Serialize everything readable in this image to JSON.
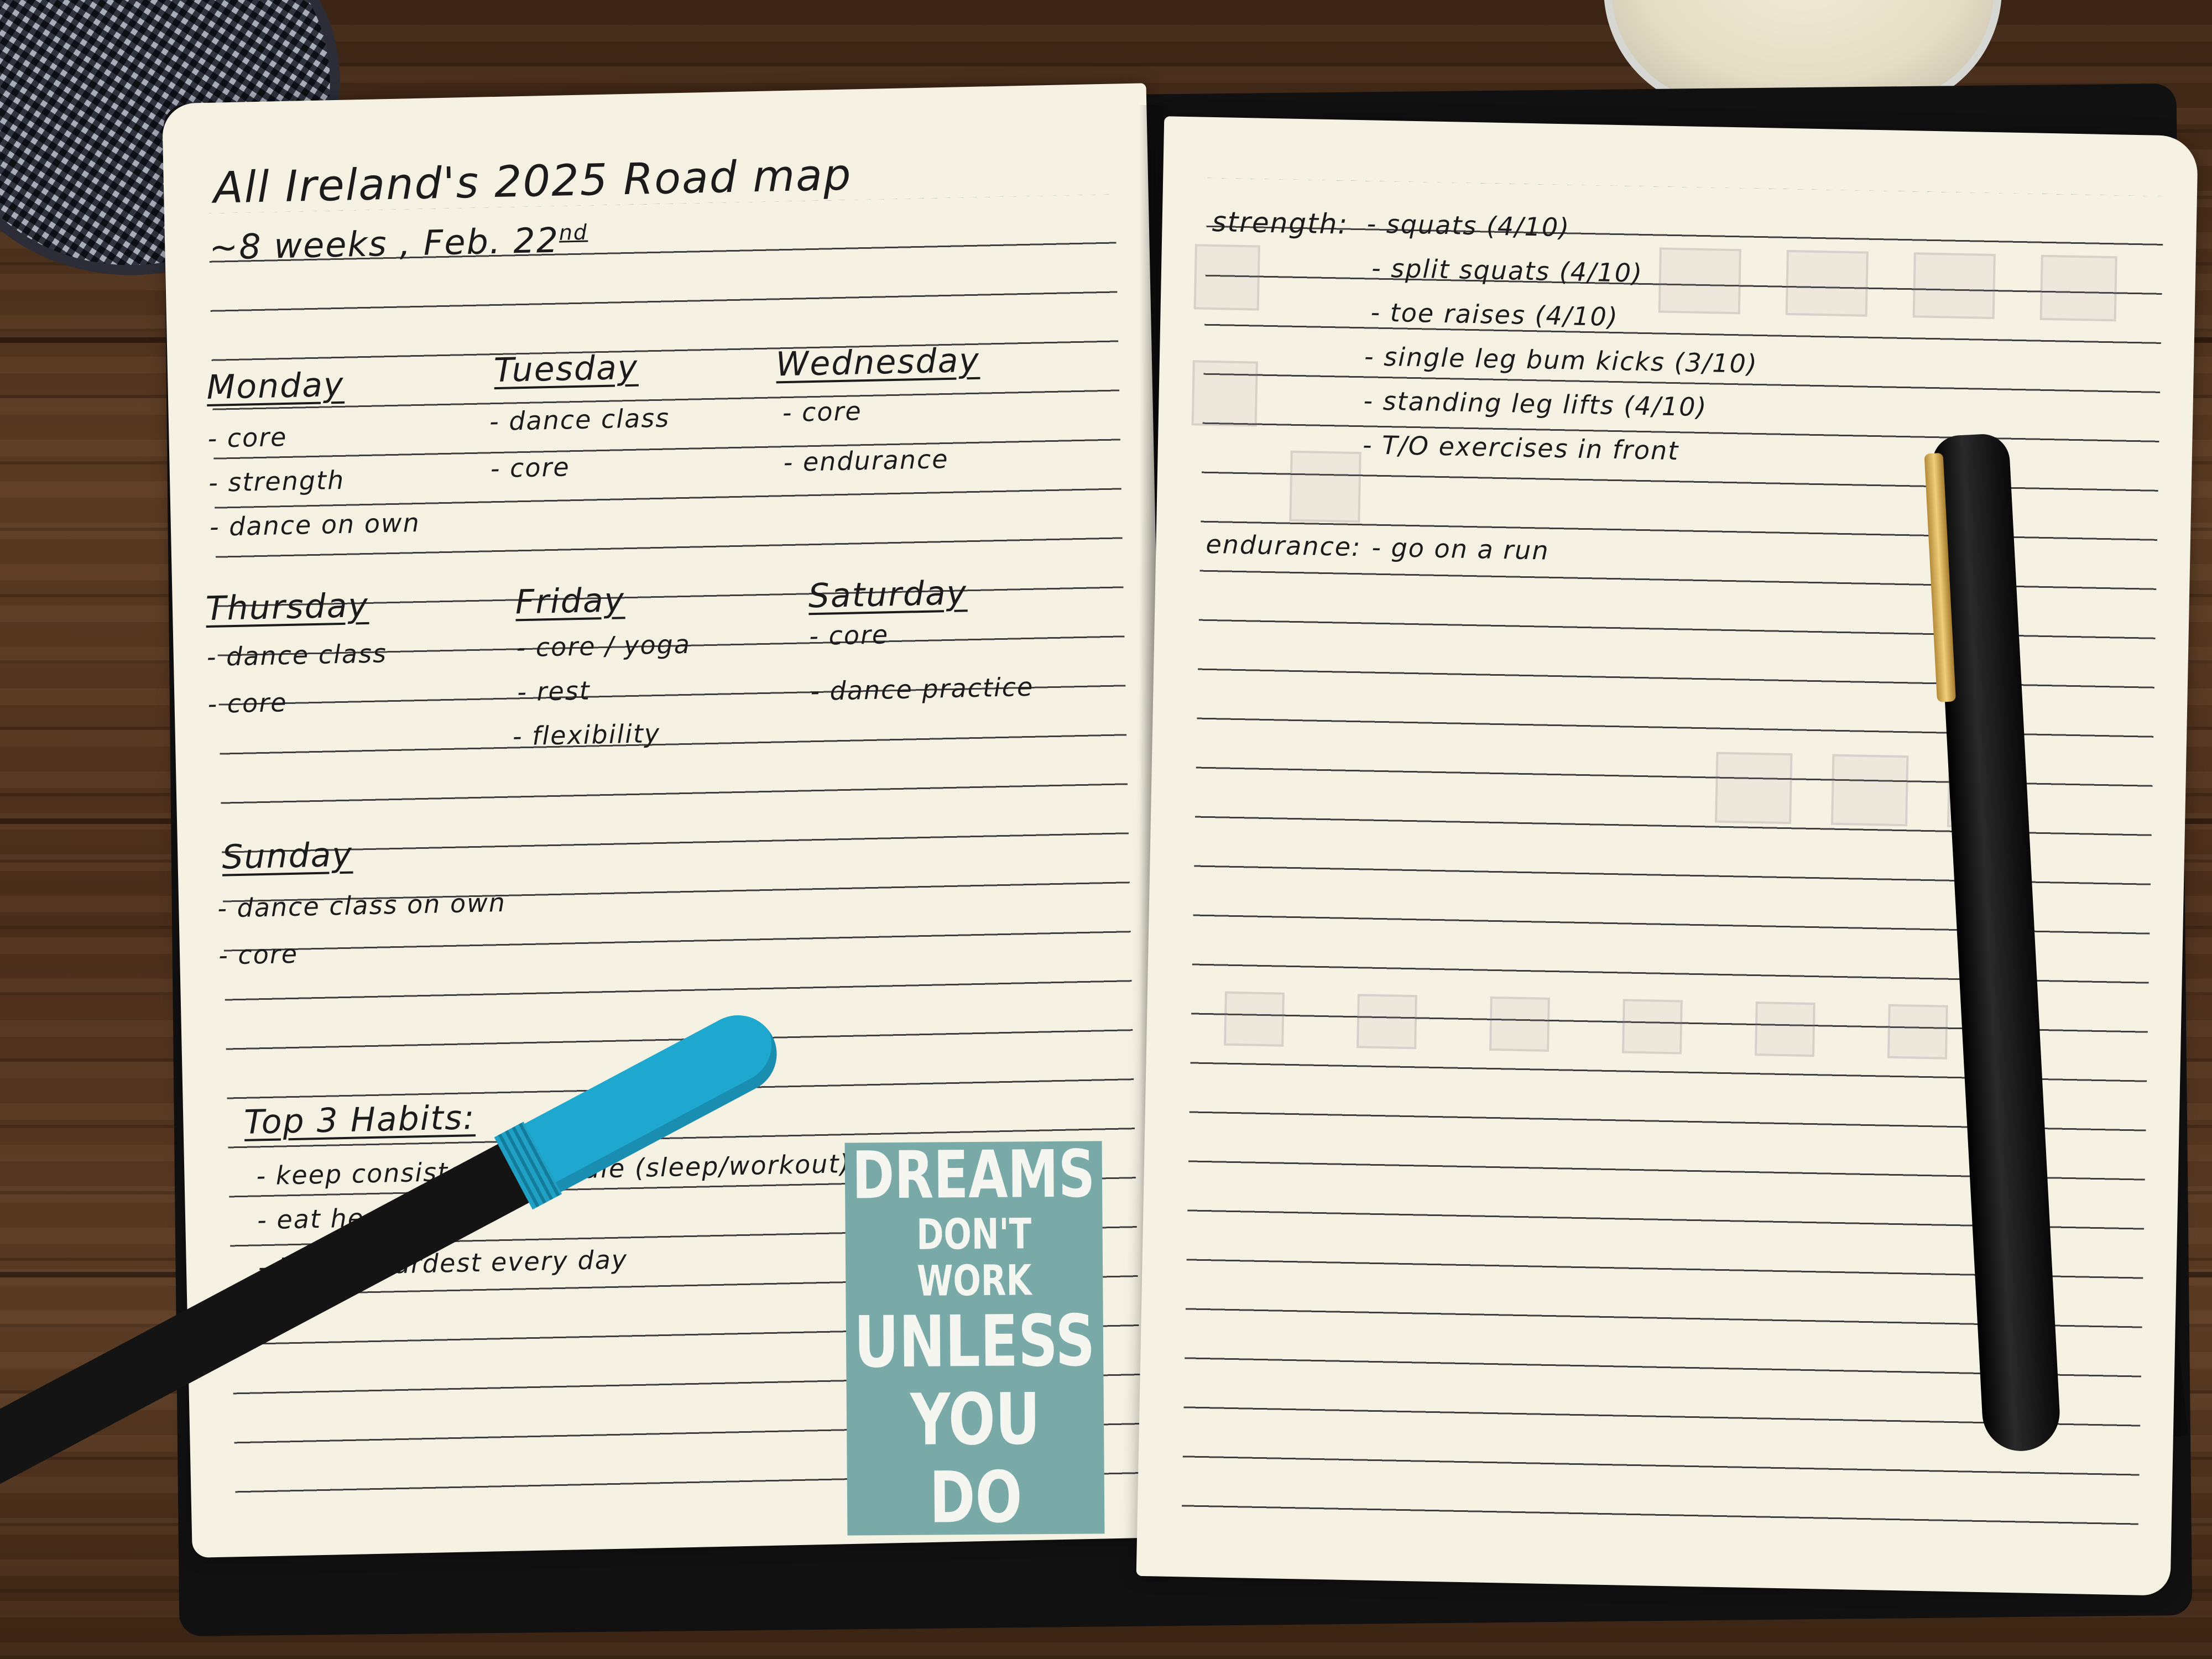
{
  "left_page": {
    "title": "All Ireland's 2025 Road map",
    "subtitle_text": "~8 weeks , Feb. 22",
    "subtitle_sup": "nd",
    "days": [
      {
        "name": "Monday",
        "items": [
          "- core",
          "- strength",
          "- dance on own"
        ]
      },
      {
        "name": "Tuesday",
        "items": [
          "- dance class",
          "- core"
        ]
      },
      {
        "name": "Wednesday",
        "items": [
          "- core",
          "- endurance"
        ]
      },
      {
        "name": "Thursday",
        "items": [
          "- dance class",
          "- core"
        ]
      },
      {
        "name": "Friday",
        "items": [
          "- core / yoga",
          "- rest",
          "- flexibility"
        ]
      },
      {
        "name": "Saturday",
        "items": [
          "- core",
          "- dance practice"
        ]
      },
      {
        "name": "Sunday",
        "items": [
          "- dance class on own",
          "- core"
        ]
      }
    ],
    "habits_title": "Top 3 Habits:",
    "habits": [
      "- keep consistent schedule (sleep/workout)",
      "- eat healthy",
      "- try my hardest every day"
    ]
  },
  "right_page": {
    "strength_label": "strength:",
    "strength_items": [
      "- squats (4/10)",
      "- split squats (4/10)",
      "- toe raises (4/10)",
      "- single leg bum kicks (3/10)",
      "- standing leg lifts (4/10)",
      "- T/O exercises in front"
    ],
    "endurance_label": "endurance:",
    "endurance_item": "- go on a run"
  },
  "card": {
    "line1": "DREAMS",
    "line2": "DON'T WORK",
    "line3": "UNLESS",
    "line4": "YOU DO",
    "color": "#79aaa8"
  },
  "colors": {
    "paper": "#f5f1e3",
    "wood": "#4a2f1d",
    "blue_pen_cap": "#1ea7cf",
    "ink": "#1b1b1b"
  }
}
